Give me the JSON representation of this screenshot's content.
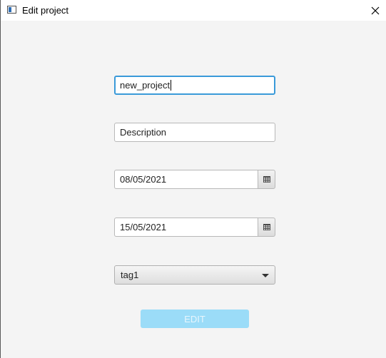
{
  "window": {
    "title": "Edit project",
    "close_icon": "close-icon",
    "app_icon": "window-app-icon"
  },
  "form": {
    "name_value": "new_project",
    "description_placeholder": "Description",
    "start_date": "08/05/2021",
    "end_date": "15/05/2021",
    "tag_selected": "tag1",
    "submit_label": "EDIT"
  },
  "colors": {
    "focus_border": "#3a9ad9",
    "edit_button_bg": "#9bdcf8"
  }
}
